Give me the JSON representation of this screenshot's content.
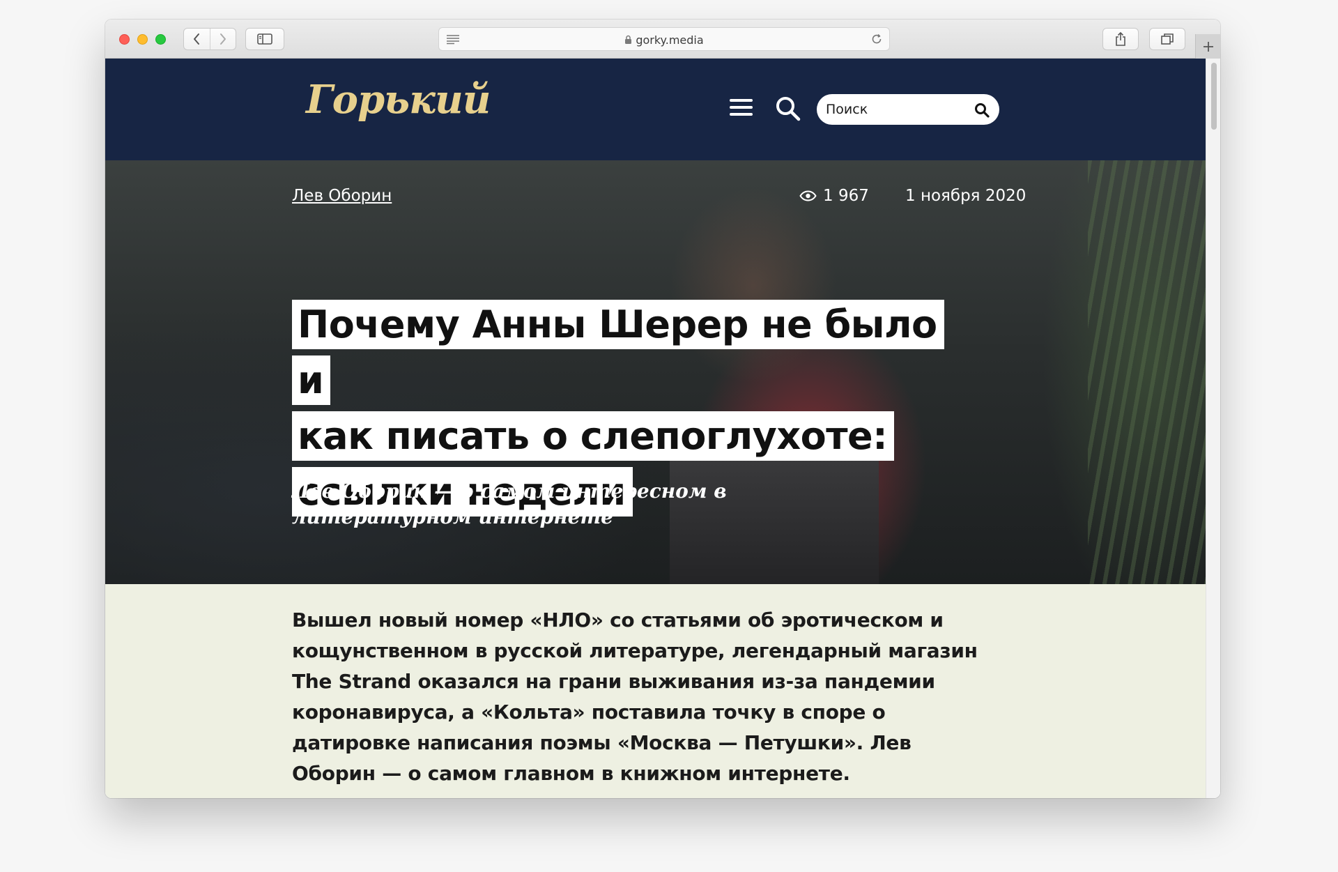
{
  "browser": {
    "url": "gorky.media"
  },
  "site": {
    "logo": "Горький",
    "search_placeholder": "Поиск"
  },
  "article": {
    "author": "Лев Оборин",
    "views": "1 967",
    "date": "1 ноября 2020",
    "title_lines": [
      "Почему Анны Шерер не было и",
      "как писать о слепоглухоте:",
      "ссылки недели"
    ],
    "lead": "Лев Оборин — о самом интересном в литературном интернете",
    "intro": "Вышел новый номер «НЛО» со статьями об эротическом и кощунственном в русской литературе, легендарный магазин The Strand оказался на грани выживания из-за пандемии коронавируса, а «Кольта» поставила точку в споре о датировке написания поэмы «Москва — Петушки». Лев Оборин — о самом главном в книжном интернете."
  },
  "icons": {
    "back": "chevron-left-icon",
    "forward": "chevron-right-icon",
    "sidebar": "sidebar-icon",
    "reader": "reader-icon",
    "lock": "lock-icon",
    "reload": "reload-icon",
    "share": "share-icon",
    "tabs": "tabs-icon",
    "new_tab": "plus-icon",
    "menu": "hamburger-icon",
    "search": "search-icon",
    "views": "eye-icon"
  },
  "colors": {
    "header_bg": "#172544",
    "logo": "#e7d08d",
    "intro_bg": "#eef0e2"
  }
}
